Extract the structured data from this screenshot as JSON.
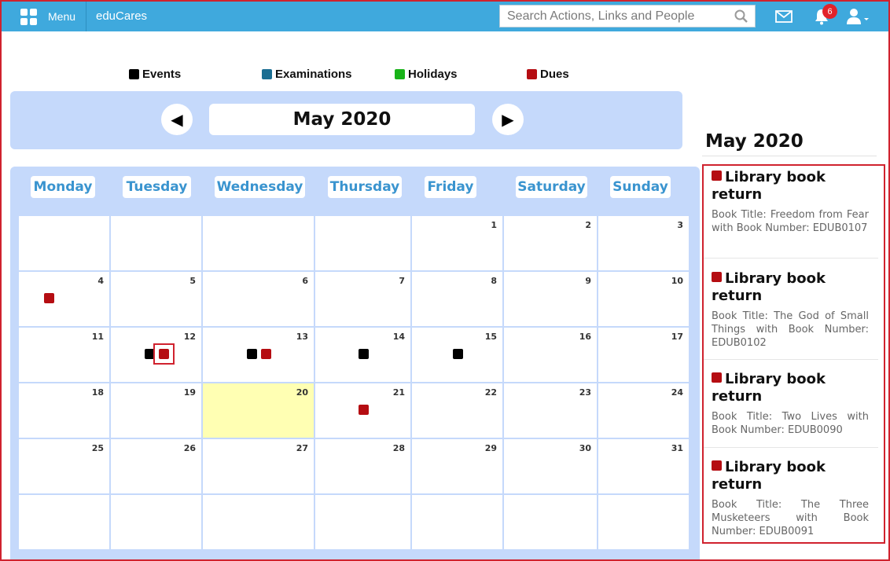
{
  "topbar": {
    "menu_label": "Menu",
    "brand": "eduCares",
    "search_placeholder": "Search Actions, Links and People",
    "notification_count": "6"
  },
  "legend": [
    {
      "label": "Events",
      "color": "#000000"
    },
    {
      "label": "Examinations",
      "color": "#1a6e92"
    },
    {
      "label": "Holidays",
      "color": "#19b319"
    },
    {
      "label": "Dues",
      "color": "#b50d12"
    }
  ],
  "calendar": {
    "month_title": "May 2020",
    "prev_icon": "◀",
    "next_icon": "▶",
    "weekdays": [
      "Monday",
      "Tuesday",
      "Wednesday",
      "Thursday",
      "Friday",
      "Saturday",
      "Sunday"
    ],
    "today": 20,
    "weeks": [
      [
        "",
        "",
        "",
        "",
        "1",
        "2",
        "3"
      ],
      [
        "4",
        "5",
        "6",
        "7",
        "8",
        "9",
        "10"
      ],
      [
        "11",
        "12",
        "13",
        "14",
        "15",
        "16",
        "17"
      ],
      [
        "18",
        "19",
        "20",
        "21",
        "22",
        "23",
        "24"
      ],
      [
        "25",
        "26",
        "27",
        "28",
        "29",
        "30",
        "31"
      ],
      [
        "",
        "",
        "",
        "",
        "",
        "",
        ""
      ]
    ],
    "markers": {
      "4": [
        "due"
      ],
      "12": [
        "event",
        "due"
      ],
      "13": [
        "event",
        "due"
      ],
      "14": [
        "event"
      ],
      "15": [
        "event"
      ],
      "21": [
        "due"
      ]
    },
    "selected": {
      "day": 12,
      "type": "due"
    }
  },
  "side": {
    "title": "May 2020",
    "entries": [
      {
        "title": "Library book return",
        "desc": "Book Title: Freedom from Fear with Book Number: EDUB0107"
      },
      {
        "title": "Library book return",
        "desc": "Book Title: The God of Small Things with Book Number: EDUB0102"
      },
      {
        "title": "Library book return",
        "desc": "Book Title: Two Lives with Book Number: EDUB0090"
      },
      {
        "title": "Library book return",
        "desc": "Book Title: The Three Musketeers with Book Number: EDUB0091"
      }
    ]
  }
}
